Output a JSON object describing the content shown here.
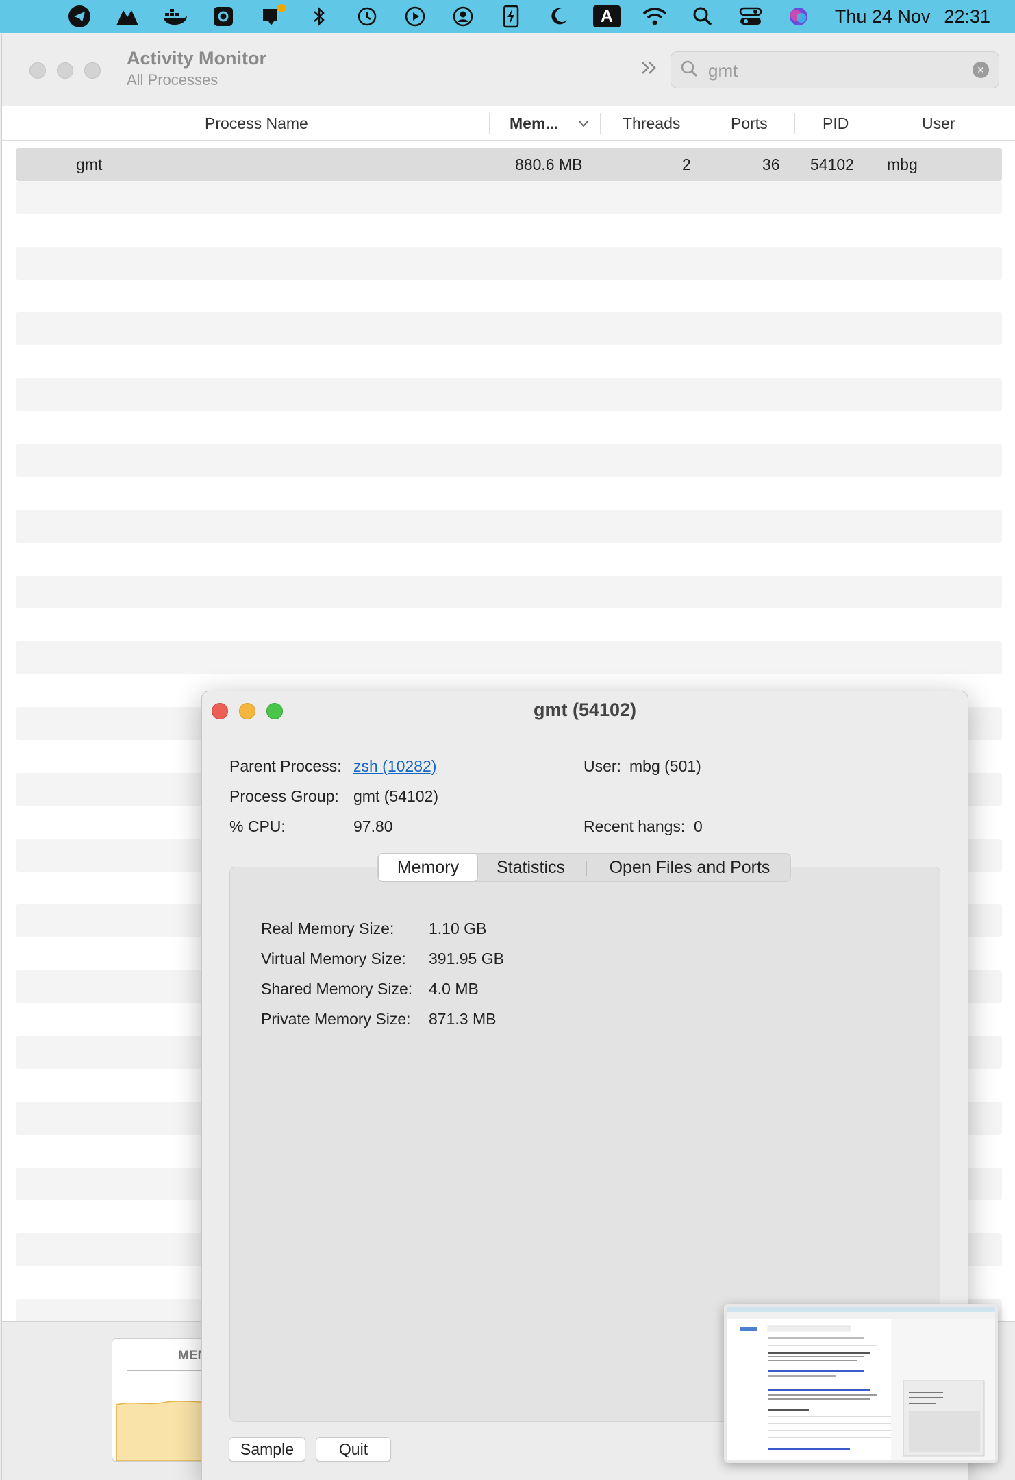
{
  "menubar": {
    "icons": [
      "telegram-icon",
      "mountain-icon",
      "docker-icon",
      "gear-badge-icon",
      "notification-bell-icon",
      "bluetooth-icon",
      "time-machine-icon",
      "play-icon",
      "user-account-icon",
      "battery-bolt-icon",
      "moon-icon",
      "input-a-icon",
      "wifi-icon",
      "search-icon",
      "control-center-icon",
      "siri-icon"
    ],
    "input_letter": "A",
    "date": "Thu 24 Nov",
    "time": "22:31"
  },
  "window": {
    "title": "Activity Monitor",
    "subtitle": "All Processes",
    "search": {
      "value": "gmt"
    }
  },
  "table": {
    "columns": [
      "Process Name",
      "Mem...",
      "Threads",
      "Ports",
      "PID",
      "User"
    ],
    "rows": [
      {
        "name": "gmt",
        "memory": "880.6 MB",
        "threads": "2",
        "ports": "36",
        "pid": "54102",
        "user": "mbg"
      }
    ]
  },
  "bottom_panel": {
    "label": "MEM"
  },
  "inspector": {
    "title": "gmt (54102)",
    "parent_process_label": "Parent Process:",
    "parent_process_value": "zsh (10282)",
    "user_label": "User:",
    "user_value": "mbg (501)",
    "process_group_label": "Process Group:",
    "process_group_value": "gmt (54102)",
    "cpu_label": "% CPU:",
    "cpu_value": "97.80",
    "recent_hangs_label": "Recent hangs:",
    "recent_hangs_value": "0",
    "tabs": [
      "Memory",
      "Statistics",
      "Open Files and Ports"
    ],
    "active_tab": "Memory",
    "memory": [
      {
        "label": "Real Memory Size:",
        "value": "1.10 GB"
      },
      {
        "label": "Virtual Memory Size:",
        "value": "391.95 GB"
      },
      {
        "label": "Shared Memory Size:",
        "value": "4.0 MB"
      },
      {
        "label": "Private Memory Size:",
        "value": "871.3 MB"
      }
    ],
    "buttons": {
      "sample": "Sample",
      "quit": "Quit"
    }
  },
  "colors": {
    "menubar": "#61c7e6",
    "close": "#ec5f57",
    "minimize": "#f4b63f",
    "maximize": "#4bc44a",
    "link": "#1466c8",
    "memory_graph": "#f9e3a8"
  }
}
